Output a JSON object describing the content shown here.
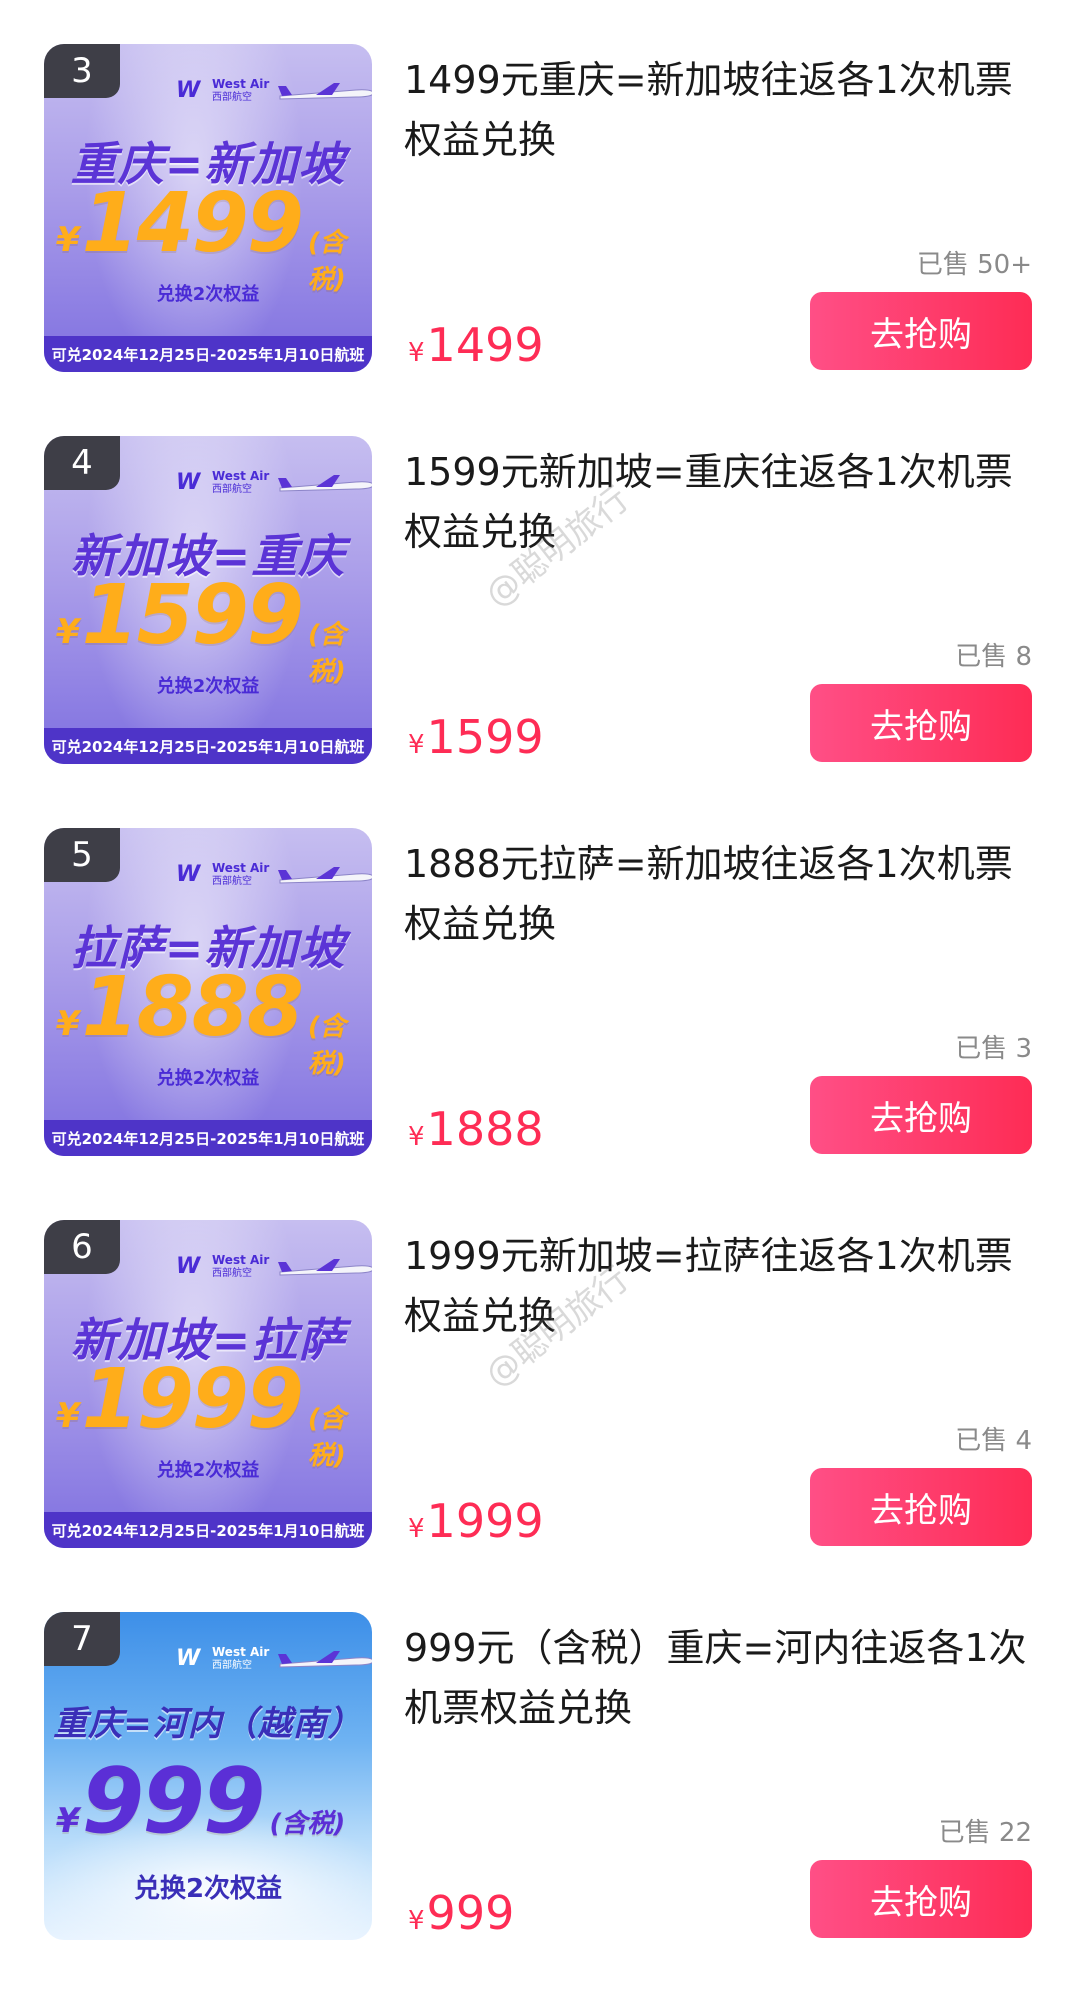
{
  "products": [
    {
      "rank": "3",
      "route": "重庆=新加坡",
      "currency": "¥",
      "big_price": "1499",
      "tax_note": "(含税)",
      "exchange": "兑换2次权益",
      "dates": "可兑2024年12月25日-2025年1月10日航班",
      "title": "1499元重庆=新加坡往返各1次机票权益兑换",
      "sold": "已售 50+",
      "price": "1499",
      "buy_label": "去抢购"
    },
    {
      "rank": "4",
      "route": "新加坡=重庆",
      "currency": "¥",
      "big_price": "1599",
      "tax_note": "(含税)",
      "exchange": "兑换2次权益",
      "dates": "可兑2024年12月25日-2025年1月10日航班",
      "title": "1599元新加坡=重庆往返各1次机票权益兑换",
      "sold": "已售 8",
      "price": "1599",
      "buy_label": "去抢购"
    },
    {
      "rank": "5",
      "route": "拉萨=新加坡",
      "currency": "¥",
      "big_price": "1888",
      "tax_note": "(含税)",
      "exchange": "兑换2次权益",
      "dates": "可兑2024年12月25日-2025年1月10日航班",
      "title": "1888元拉萨=新加坡往返各1次机票权益兑换",
      "sold": "已售 3",
      "price": "1888",
      "buy_label": "去抢购"
    },
    {
      "rank": "6",
      "route": "新加坡=拉萨",
      "currency": "¥",
      "big_price": "1999",
      "tax_note": "(含税)",
      "exchange": "兑换2次权益",
      "dates": "可兑2024年12月25日-2025年1月10日航班",
      "title": "1999元新加坡=拉萨往返各1次机票权益兑换",
      "sold": "已售 4",
      "price": "1999",
      "buy_label": "去抢购"
    },
    {
      "rank": "7",
      "route": "重庆=河内（越南）",
      "currency": "¥",
      "big_price": "999",
      "tax_note": "(含税)",
      "exchange": "兑换2次权益",
      "dates": "",
      "title": "999元（含税）重庆=河内往返各1次机票权益兑换",
      "sold": "已售 22",
      "price": "999",
      "buy_label": "去抢购"
    }
  ],
  "brand": {
    "name_en": "West Air",
    "name_cn": "西部航空",
    "logo_icon": "west-air-logo-icon",
    "plane_icon": "airplane-icon"
  },
  "price_currency": "¥",
  "watermark": "@聪明旅行",
  "colors": {
    "accent": "#fe2c55",
    "sold_text": "#8a8a8a",
    "banner_purple": "#5b34d6",
    "banner_orange": "#ffad1a"
  }
}
